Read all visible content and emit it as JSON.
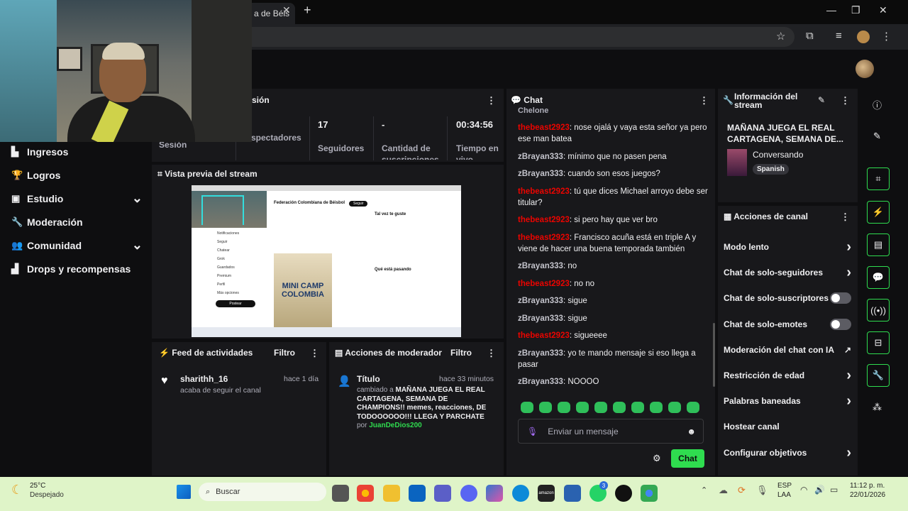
{
  "browser": {
    "tab_title": "a de Béis",
    "tab_close": "✕",
    "new_tab": "+",
    "win_min": "—",
    "win_max": "❐",
    "win_close": "✕"
  },
  "nav": {
    "items": [
      {
        "label": "Ingresos",
        "icon": "revenue-icon",
        "chevron": false
      },
      {
        "label": "Logros",
        "icon": "trophy-icon",
        "chevron": false
      },
      {
        "label": "Estudio",
        "icon": "studio-icon",
        "chevron": true
      },
      {
        "label": "Moderación",
        "icon": "wrench-icon",
        "chevron": false
      },
      {
        "label": "Comunidad",
        "icon": "community-icon",
        "chevron": true
      },
      {
        "label": "Drops y recompensas",
        "icon": "drops-icon",
        "chevron": false
      }
    ]
  },
  "session": {
    "title_partial": "sión",
    "stats": [
      {
        "value": "",
        "label": "Sesión"
      },
      {
        "value": "",
        "label": "Espectadores"
      },
      {
        "value": "17",
        "label": "Seguidores"
      },
      {
        "value": "-",
        "label": "Cantidad de suscripciones"
      },
      {
        "value": "00:34:56",
        "label": "Tiempo en vivo"
      }
    ]
  },
  "preview": {
    "title": "Vista previa del stream",
    "page_title": "Federación Colombiana de Béisbol",
    "follow": "Seguir",
    "poster_line1": "MINI CAMP",
    "poster_line2": "COLOMBIA",
    "sidebar": [
      "Notificaciones",
      "Seguir",
      "Chatear",
      "Grok",
      "Guardados",
      "Premium",
      "Perfil",
      "Más opciones"
    ],
    "post_btn": "Postear",
    "right_title": "Tal vez te guste",
    "right_title2": "Qué está pasando"
  },
  "feed": {
    "title": "Feed de actividades",
    "filter": "Filtro",
    "item_user": "sharithh_16",
    "item_time": "hace 1 día",
    "item_text": "acaba de seguir el canal"
  },
  "modactions": {
    "title": "Acciones de moderador",
    "filter": "Filtro",
    "item_title": "Título",
    "item_time": "hace 33 minutos",
    "item_prefix": "cambiado a",
    "item_value": "MAÑANA JUEGA EL REAL CARTAGENA, SEMANA DE CHAMPIONS!! memes, reacciones, DE TODOOOOOO!!! LLEGA Y PARCHATE",
    "item_by": "por",
    "item_user": "JuanDeDios200"
  },
  "chat": {
    "title": "Chat",
    "truncated_top": "Chelone",
    "messages": [
      {
        "user": "thebeast2923",
        "color": "#eb0400",
        "text": "nose ojalá y vaya esta señor ya pero ese man batea"
      },
      {
        "user": "zBrayan333",
        "color": "#c4c4cc",
        "text": "mínimo que no pasen pena"
      },
      {
        "user": "zBrayan333",
        "color": "#c4c4cc",
        "text": "cuando son esos juegos?"
      },
      {
        "user": "thebeast2923",
        "color": "#eb0400",
        "text": "tú que dices Michael arroyo debe ser titular?"
      },
      {
        "user": "thebeast2923",
        "color": "#eb0400",
        "text": "si pero hay que ver bro"
      },
      {
        "user": "thebeast2923",
        "color": "#eb0400",
        "text": "Francisco acuña está en triple A y viene de hacer una buena temporada también"
      },
      {
        "user": "zBrayan333",
        "color": "#c4c4cc",
        "text": "no"
      },
      {
        "user": "thebeast2923",
        "color": "#eb0400",
        "text": "no no"
      },
      {
        "user": "zBrayan333",
        "color": "#c4c4cc",
        "text": "sigue"
      },
      {
        "user": "zBrayan333",
        "color": "#c4c4cc",
        "text": "sigue"
      },
      {
        "user": "thebeast2923",
        "color": "#eb0400",
        "text": "sigueeee"
      },
      {
        "user": "zBrayan333",
        "color": "#c4c4cc",
        "text": "yo te mando mensaje si eso llega a pasar"
      },
      {
        "user": "zBrayan333",
        "color": "#c4c4cc",
        "text": "NOOOO"
      }
    ],
    "input_placeholder": "Enviar un mensaje",
    "send_label": "Chat",
    "emote_count": 10
  },
  "streaminfo": {
    "title": "Información del stream",
    "stream_title": "MAÑANA JUEGA EL REAL CARTAGENA, SEMANA DE...",
    "category": "Conversando",
    "tag": "Spanish"
  },
  "channel_actions": {
    "title": "Acciones de canal",
    "items": [
      {
        "label": "Modo lento",
        "kind": "chevron"
      },
      {
        "label": "Chat de solo-seguidores",
        "kind": "chevron"
      },
      {
        "label": "Chat de solo-suscriptores",
        "kind": "toggle"
      },
      {
        "label": "Chat de solo-emotes",
        "kind": "toggle"
      },
      {
        "label": "Moderación del chat con IA",
        "kind": "external"
      },
      {
        "label": "Restricción de edad",
        "kind": "chevron"
      },
      {
        "label": "Palabras baneadas",
        "kind": "chevron"
      },
      {
        "label": "Hostear canal",
        "kind": "none"
      },
      {
        "label": "Configurar objetivos",
        "kind": "chevron"
      }
    ]
  },
  "taskbar": {
    "weather_temp": "25°C",
    "weather_desc": "Despejado",
    "search": "Buscar",
    "lang1": "ESP",
    "lang2": "LAA",
    "time": "11:12 p. m.",
    "date": "22/01/2026",
    "badge": "3"
  },
  "colors": {
    "accent": "#2fdc4f",
    "panel": "#18181b",
    "bg": "#0e0e10",
    "red_user": "#eb0400"
  }
}
